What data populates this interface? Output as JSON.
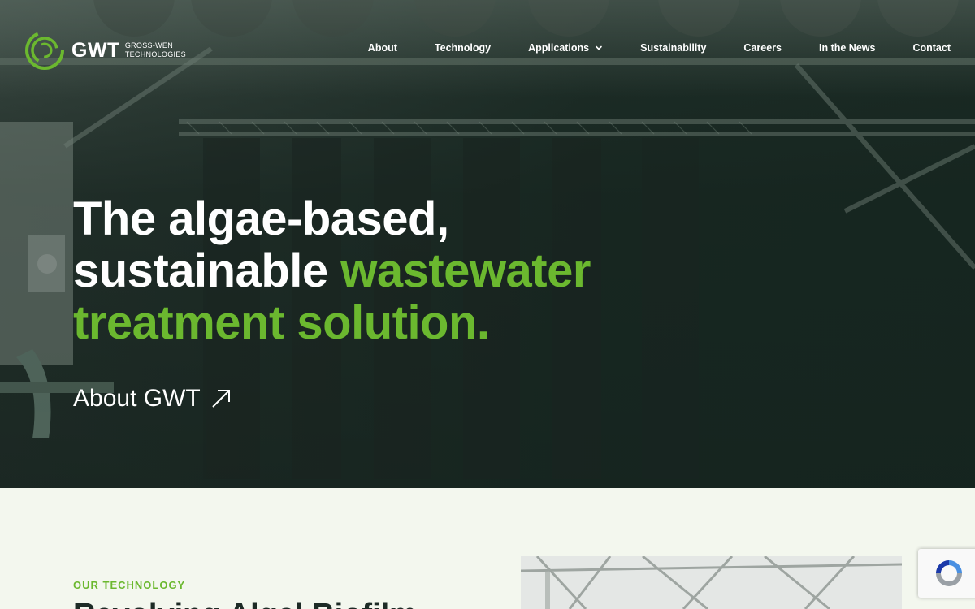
{
  "header": {
    "logo_text": "GWT",
    "logo_sub_line1": "GROSS-WEN",
    "logo_sub_line2": "TECHNOLOGIES",
    "nav": [
      {
        "label": "About"
      },
      {
        "label": "Technology"
      },
      {
        "label": "Applications",
        "has_dropdown": true
      },
      {
        "label": "Sustainability"
      },
      {
        "label": "Careers"
      },
      {
        "label": "In the News"
      },
      {
        "label": "Contact"
      }
    ]
  },
  "hero": {
    "headline_part1": "The algae-based,",
    "headline_part2": "sustainable ",
    "headline_highlight": "wastewater treatment solution.",
    "cta_label": "About GWT"
  },
  "technology": {
    "eyebrow": "OUR TECHNOLOGY",
    "title": "Revolving Algal Biofilm"
  },
  "colors": {
    "accent_green": "#6bb82f",
    "hero_dark": "#1e2925",
    "section_bg": "#f3f7ee",
    "text_dark": "#1d2b26"
  },
  "icons": {
    "logo": "gwt-swirl-logo",
    "dropdown": "chevron-down-icon",
    "cta": "arrow-up-right-icon",
    "recaptcha": "recaptcha-icon"
  }
}
